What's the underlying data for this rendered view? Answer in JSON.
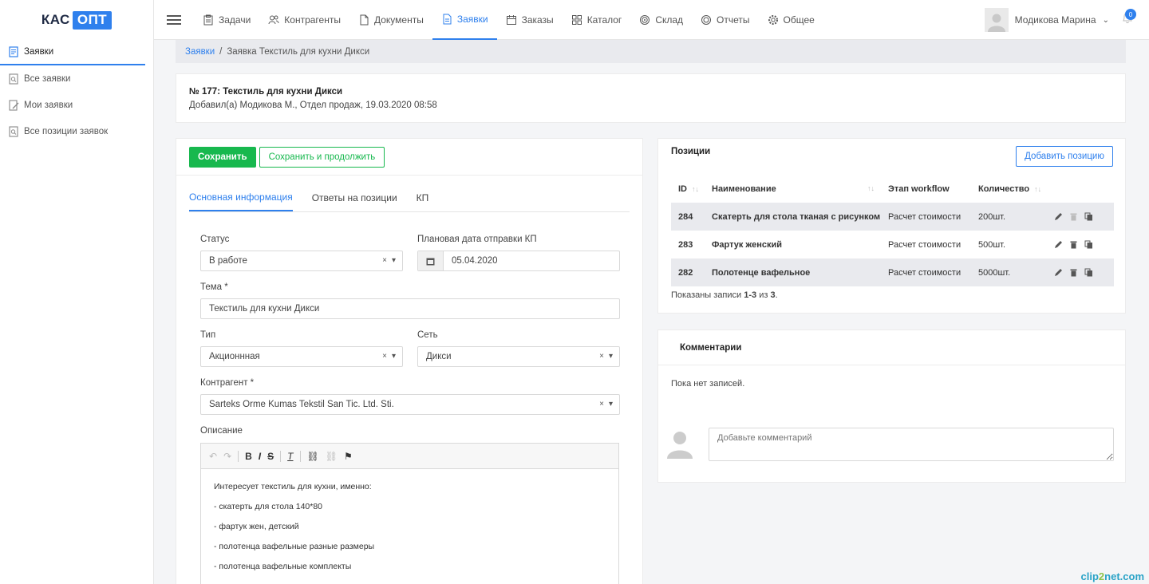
{
  "logo": {
    "left": "КАС",
    "right": "ОПТ"
  },
  "sidebar": {
    "items": [
      {
        "label": "Заявки",
        "icon": "document-icon",
        "active": true
      },
      {
        "label": "Все заявки",
        "icon": "search-doc-icon"
      },
      {
        "label": "Мои заявки",
        "icon": "edit-doc-icon"
      },
      {
        "label": "Все позиции заявок",
        "icon": "search-doc-icon"
      }
    ]
  },
  "topnav": {
    "items": [
      {
        "label": "Задачи"
      },
      {
        "label": "Контрагенты"
      },
      {
        "label": "Документы"
      },
      {
        "label": "Заявки"
      },
      {
        "label": "Заказы"
      },
      {
        "label": "Каталог"
      },
      {
        "label": "Склад"
      },
      {
        "label": "Отчеты"
      },
      {
        "label": "Общее"
      }
    ],
    "user_name": "Модикова Марина",
    "notif_count": "0"
  },
  "breadcrumb": {
    "root": "Заявки",
    "sep": "/",
    "current": "Заявка Текстиль для кухни Дикси"
  },
  "header": {
    "title": "№ 177: Текстиль для кухни Дикси",
    "subtitle": "Добавил(а) Модикова М., Отдел продаж, 19.03.2020 08:58"
  },
  "form": {
    "save_label": "Сохранить",
    "save_continue_label": "Сохранить и продолжить",
    "tabs": [
      {
        "label": "Основная информация"
      },
      {
        "label": "Ответы на позиции"
      },
      {
        "label": "КП"
      }
    ],
    "status_label": "Статус",
    "status_value": "В работе",
    "date_label": "Плановая дата отправки КП",
    "date_value": "05.04.2020",
    "theme_label": "Тема *",
    "theme_value": "Текстиль для кухни Дикси",
    "type_label": "Тип",
    "type_value": "Акционнная",
    "network_label": "Сеть",
    "network_value": "Дикси",
    "counterparty_label": "Контрагент *",
    "counterparty_value": "Sarteks Orme Kumas Tekstil San Tic. Ltd. Sti.",
    "description_label": "Описание",
    "description_lines": [
      "Интересует текстиль для кухни, именно:",
      "- скатерть для стола 140*80",
      "- фартук жен, детский",
      "- полотенца вафельные разные размеры",
      "- полотенца вафельные комплекты"
    ],
    "clear_symbol": "×",
    "caret_symbol": "▾"
  },
  "positions": {
    "title": "Позиции",
    "add_label": "Добавить позицию",
    "columns": [
      "ID",
      "Наименование",
      "Этап workflow",
      "Количество"
    ],
    "rows": [
      {
        "id": "284",
        "name": "Скатерть для стола тканая с рисунком",
        "stage": "Расчет стоимости",
        "qty": "200шт."
      },
      {
        "id": "283",
        "name": "Фартук женский",
        "stage": "Расчет стоимости",
        "qty": "500шт."
      },
      {
        "id": "282",
        "name": "Полотенце вафельное",
        "stage": "Расчет стоимости",
        "qty": "5000шт."
      }
    ],
    "info_prefix": "Показаны записи ",
    "info_range": "1-3",
    "info_mid": " из ",
    "info_total": "3",
    "info_suffix": "."
  },
  "comments": {
    "title": "Комментарии",
    "empty": "Пока нет записей.",
    "placeholder": "Добавьте комментарий"
  },
  "watermark": {
    "a": "clip",
    "b": "2",
    "c": "net",
    "d": ".com"
  },
  "colors": {
    "accent": "#2f80ed",
    "success": "#17b84e"
  }
}
